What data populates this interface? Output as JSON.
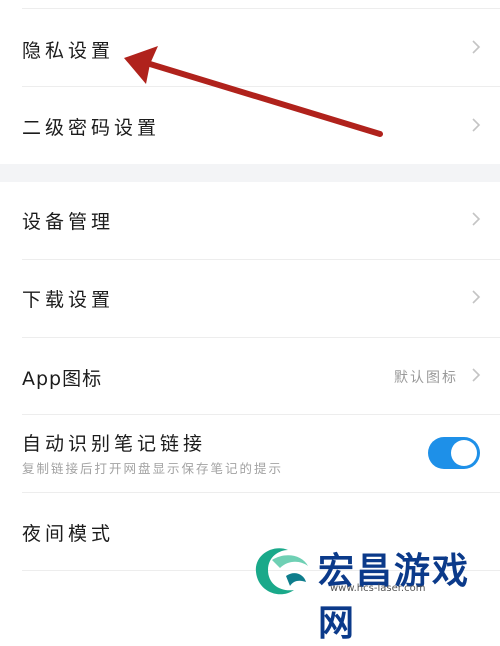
{
  "settings": {
    "privacy": {
      "label": "隐私设置"
    },
    "second_password": {
      "label": "二级密码设置"
    },
    "device_management": {
      "label": "设备管理"
    },
    "download_settings": {
      "label": "下载设置"
    },
    "app_icon": {
      "label": "App图标",
      "value": "默认图标"
    },
    "auto_detect_links": {
      "label": "自动识别笔记链接",
      "description": "复制链接后打开网盘显示保存笔记的提示",
      "enabled": true
    },
    "night_mode": {
      "label": "夜间模式"
    }
  },
  "watermark": {
    "brand": "宏昌游戏网",
    "url": "www.hcs-laser.com"
  },
  "colors": {
    "toggle_on": "#1e90e8",
    "annotation_arrow": "#b0221c",
    "watermark_text": "#0b3a8a",
    "section_gap": "#f3f4f6"
  }
}
